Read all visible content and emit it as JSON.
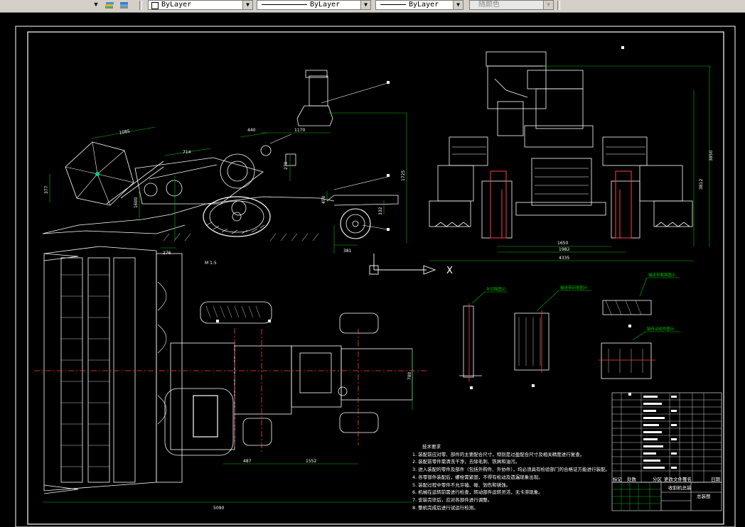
{
  "toolbar": {
    "icons": [
      "layer-states-icon",
      "layer-previous-icon"
    ],
    "color_control": "ByLayer",
    "linetype_control": "ByLayer",
    "lineweight_control": "ByLayer",
    "plotstyle_control": "随颜色"
  },
  "drawing": {
    "dimensions": {
      "d1085": "1085",
      "d714": "714",
      "d440": "440",
      "d1170": "1170",
      "d270": "270",
      "d1725": "1725",
      "d377": "377",
      "d1600": "1600",
      "d450": "450",
      "d332": "332",
      "d276": "276",
      "d381": "381",
      "d3850": "3850",
      "d3812": "3812",
      "d1650": "1650",
      "d1982": "1982",
      "d4335": "4335",
      "d780": "780",
      "d487": "487",
      "d1552": "1552",
      "d5090": "5090"
    },
    "ucs_axis_label": "X",
    "side_view_label": "M 1:5",
    "detail_labels": [
      "半切面图示",
      "输送带剖视图示",
      "输送带截面图示",
      "链传动组件图示"
    ],
    "technical_notes": {
      "title": "技术要求",
      "items": [
        "1. 装配前应对零、部件的主要配合尺寸，特别是过盈配合尺寸及相关精度进行复查。",
        "2. 装配前零件需清洗干净，去除毛刺、铁屑和油污。",
        "3. 进入装配的零件及部件（包括外购件、外协件），均必须具有检验部门的合格证方能进行装配。",
        "4. 各零部件装配后，螺栓需紧固，不得有松动及遗漏现象出现。",
        "5. 装配过程中零件不允许磕、碰、划伤和锈蚀。",
        "6. 机械在运转前需进行检查，转动部件运转灵活，无卡滞现象。",
        "7. 安装完毕后，应对各部件进行调整。",
        "8. 整机完成后进行试运行检测。"
      ]
    },
    "title_block": {
      "col_labels": [
        "标记",
        "处数",
        "分区",
        "更改文件号",
        "签名",
        "日期"
      ],
      "drawing_name": "收割机总装",
      "sub_label": "总装图"
    }
  }
}
